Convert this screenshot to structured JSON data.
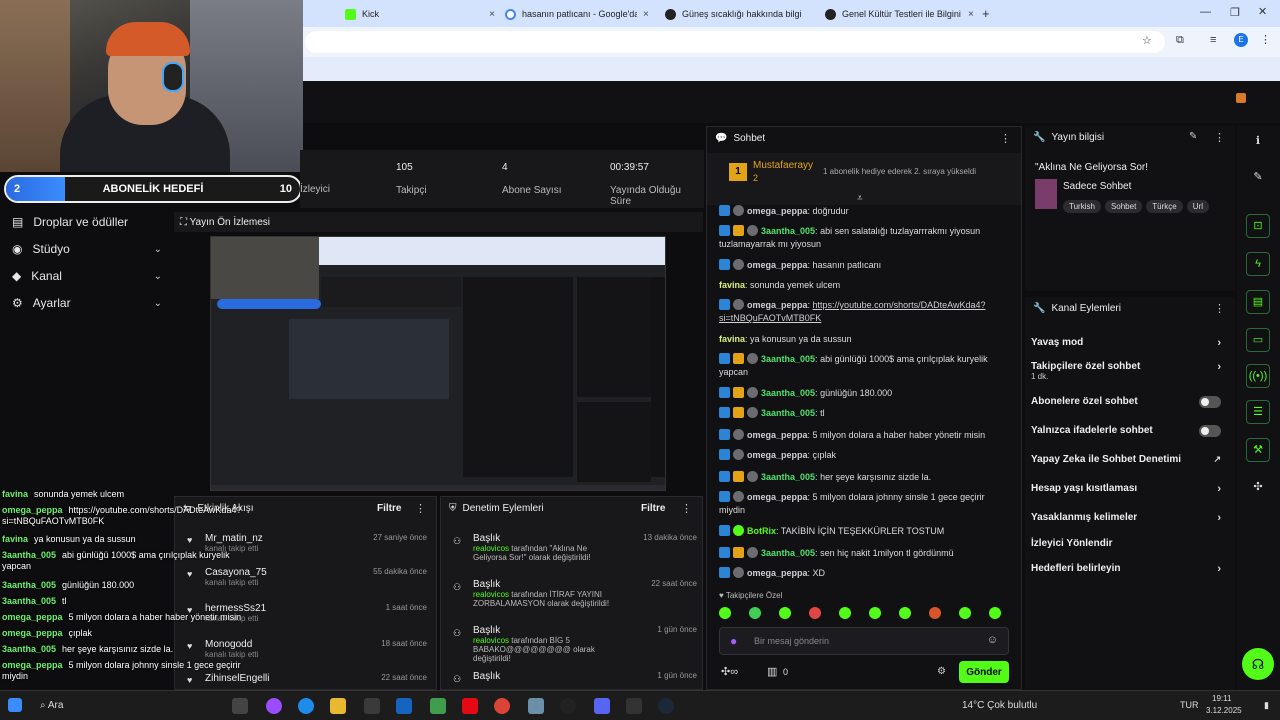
{
  "browser": {
    "tabs": [
      {
        "label": "Kick",
        "color": "#53fc18"
      },
      {
        "label": "hasanın patlıcanı - Google'da A",
        "color": "#4285f4"
      },
      {
        "label": "Güneş sıcaklığı hakkında bilgi",
        "color": "#222222"
      },
      {
        "label": "Genel Kültür Testleri ile Bilgini T",
        "color": "#222222"
      }
    ],
    "new_tab": "+",
    "profile_initial": "E",
    "close_tab": "×"
  },
  "sub_goal": {
    "count": "2",
    "title": "ABONELİK HEDEFİ",
    "target": "10",
    "fraction": 0.2
  },
  "sidebar": {
    "items": [
      {
        "label": "Droplar ve ödüller",
        "icon": "gift-icon",
        "has_chevron": false
      },
      {
        "label": "Stüdyo",
        "icon": "studio-icon",
        "has_chevron": true
      },
      {
        "label": "Kanal",
        "icon": "channel-icon",
        "has_chevron": true
      },
      {
        "label": "Ayarlar",
        "icon": "gear-icon",
        "has_chevron": true
      }
    ]
  },
  "stats": [
    {
      "value": "105",
      "label": "Takipçi"
    },
    {
      "value": "4",
      "label": "Abone Sayısı"
    },
    {
      "value": "00:39:57",
      "label": "Yayında Olduğu Süre"
    }
  ],
  "stats_partial_label": "İzleyici",
  "preview": {
    "title": "Yayın Ön İzlemesi"
  },
  "activity": {
    "title": "Etkinlik Akışı",
    "filter": "Filtre",
    "items": [
      {
        "user": "Mr_matin_nz",
        "sub": "kanalı takip etti",
        "time": "27 saniye önce"
      },
      {
        "user": "Casayona_75",
        "sub": "kanalı takip etti",
        "time": "55 dakika önce"
      },
      {
        "user": "hermessSs21",
        "sub": "kanalı takip etti",
        "time": "1 saat önce"
      },
      {
        "user": "Monogodd",
        "sub": "kanalı takip etti",
        "time": "18 saat önce"
      },
      {
        "user": "ZihinselEngelli",
        "sub": "",
        "time": "22 saat önce"
      }
    ]
  },
  "mod_actions": {
    "title": "Denetim Eylemleri",
    "filter": "Filtre",
    "items": [
      {
        "head": "Başlık",
        "by": "realovicos",
        "text": "tarafından \"Aklına Ne Geliyorsa Sor!\" olarak değiştirildi!",
        "time": "13 dakika önce"
      },
      {
        "head": "Başlık",
        "by": "realovicos",
        "text": "tarafından İTİRAF YAYINI ZORBALAMASYON olarak değiştirildi!",
        "time": "22 saat önce"
      },
      {
        "head": "Başlık",
        "by": "realovicos",
        "text": "tarafından BİG 5 BABAKO@@@@@@@@ olarak değiştirildi!",
        "time": "1 gün önce"
      },
      {
        "head": "Başlık",
        "by": "",
        "text": "",
        "time": "1 gün önce"
      }
    ]
  },
  "chat": {
    "title": "Sohbet",
    "pinned_user": "Mustafaerayy",
    "pinned_count": "2",
    "pinned_text": "1 abonelik hediye ederek 2. sıraya yükseldi",
    "messages": [
      {
        "user": "omega_peppa",
        "color": "#cfcfd4",
        "badges": [
          "blue",
          "grey"
        ],
        "text": "doğrudur"
      },
      {
        "user": "3aantha_005",
        "color": "#4ee36e",
        "badges": [
          "blue",
          "gold",
          "grey"
        ],
        "text": "abi sen salatalığı tuzlayarrrakmı yiyosun tuzlamayarrak mı yiyosun"
      },
      {
        "user": "omega_peppa",
        "color": "#cfcfd4",
        "badges": [
          "blue",
          "grey"
        ],
        "text": "hasanın patlıcanı"
      },
      {
        "user": "favina",
        "color": "#d8f279",
        "badges": [],
        "text": "sonunda yemek ulcem"
      },
      {
        "user": "omega_peppa",
        "color": "#cfcfd4",
        "badges": [
          "blue",
          "grey"
        ],
        "text": "https://youtube.com/shorts/DADteAwKda4?si=tNBQuFAOTvMTB0FK"
      },
      {
        "user": "favina",
        "color": "#d8f279",
        "badges": [],
        "text": "ya konusun ya da sussun"
      },
      {
        "user": "3aantha_005",
        "color": "#4ee36e",
        "badges": [
          "blue",
          "gold",
          "grey"
        ],
        "text": "abi günlüğü 1000$ ama çırılçıplak kuryelik yapcan"
      },
      {
        "user": "3aantha_005",
        "color": "#4ee36e",
        "badges": [
          "blue",
          "gold",
          "grey"
        ],
        "text": "günlüğün 180.000"
      },
      {
        "user": "3aantha_005",
        "color": "#4ee36e",
        "badges": [
          "blue",
          "gold",
          "grey"
        ],
        "text": "tl"
      },
      {
        "user": "omega_peppa",
        "color": "#cfcfd4",
        "badges": [
          "blue",
          "grey"
        ],
        "text": "5 milyon dolara a haber haber yönetir misin"
      },
      {
        "user": "omega_peppa",
        "color": "#cfcfd4",
        "badges": [
          "blue",
          "grey"
        ],
        "text": "çıplak"
      },
      {
        "user": "3aantha_005",
        "color": "#4ee36e",
        "badges": [
          "blue",
          "gold",
          "grey"
        ],
        "text": "her şeye karşısınız sizde la."
      },
      {
        "user": "omega_peppa",
        "color": "#cfcfd4",
        "badges": [
          "blue",
          "grey"
        ],
        "text": "5 milyon dolara johnny sinsle 1 gece geçirir miydin"
      },
      {
        "user": "BotRix",
        "color": "#53fc18",
        "badges": [
          "blue",
          "green"
        ],
        "text": "TAKİBİN İÇİN TEŞEKKÜRLER TOSTUM"
      },
      {
        "user": "3aantha_005",
        "color": "#4ee36e",
        "badges": [
          "blue",
          "gold",
          "grey"
        ],
        "text": "sen hiç nakit 1milyon tl gördünmü"
      },
      {
        "user": "omega_peppa",
        "color": "#cfcfd4",
        "badges": [
          "blue",
          "grey"
        ],
        "text": "XD"
      }
    ],
    "followers_only_label": "Takipçilere Özel",
    "input_placeholder": "Bir mesaj gönderin",
    "points": "0",
    "send_label": "Gönder"
  },
  "stream_info": {
    "title": "Yayın bilgisi",
    "stream_title": "\"Aklına Ne Geliyorsa Sor!",
    "category": "Sadece Sohbet",
    "tags": [
      "Turkish",
      "Sohbet",
      "Türkçe",
      "Url"
    ]
  },
  "channel_actions": {
    "title": "Kanal Eylemleri",
    "rows": [
      {
        "label": "Yavaş mod",
        "sub": "",
        "control": "chevron"
      },
      {
        "label": "Takipçilere özel sohbet",
        "sub": "1 dk.",
        "control": "chevron"
      },
      {
        "label": "Abonelere özel sohbet",
        "sub": "",
        "control": "toggle"
      },
      {
        "label": "Yalnızca ifadelerle sohbet",
        "sub": "",
        "control": "toggle"
      },
      {
        "label": "Yapay Zeka ile Sohbet Denetimi",
        "sub": "",
        "control": "external"
      },
      {
        "label": "Hesap yaşı kısıtlaması",
        "sub": "",
        "control": "chevron"
      },
      {
        "label": "Yasaklanmış kelimeler",
        "sub": "",
        "control": "chevron"
      },
      {
        "label": "İzleyici Yönlendir",
        "sub": "",
        "control": "none"
      },
      {
        "label": "Hedefleri belirleyin",
        "sub": "",
        "control": "chevron"
      }
    ]
  },
  "overlay_chat": [
    {
      "user": "favina",
      "text": "sonunda yemek ulcem"
    },
    {
      "user": "omega_peppa",
      "text": "https://youtube.com/shorts/DADteAwKda4?si=tNBQuFAOTvMTB0FK"
    },
    {
      "user": "favina",
      "text": "ya konusun ya da sussun"
    },
    {
      "user": "3aantha_005",
      "text": "abi günlüğü 1000$ ama çırılçıplak kuryelik yapcan"
    },
    {
      "user": "3aantha_005",
      "text": "günlüğün 180.000"
    },
    {
      "user": "3aantha_005",
      "text": "tl"
    },
    {
      "user": "omega_peppa",
      "text": "5 milyon dolara a haber haber yönetir misin"
    },
    {
      "user": "omega_peppa",
      "text": "çıplak"
    },
    {
      "user": "3aantha_005",
      "text": "her şeye karşısınız sizde la."
    },
    {
      "user": "omega_peppa",
      "text": "5 milyon dolara johnny sinsle 1 gece geçirir miydin"
    }
  ],
  "taskbar": {
    "search": "Ara",
    "weather": "14°C  Çok bulutlu",
    "lang": "TUR",
    "time": "19:11",
    "date": "3.12.2025"
  }
}
